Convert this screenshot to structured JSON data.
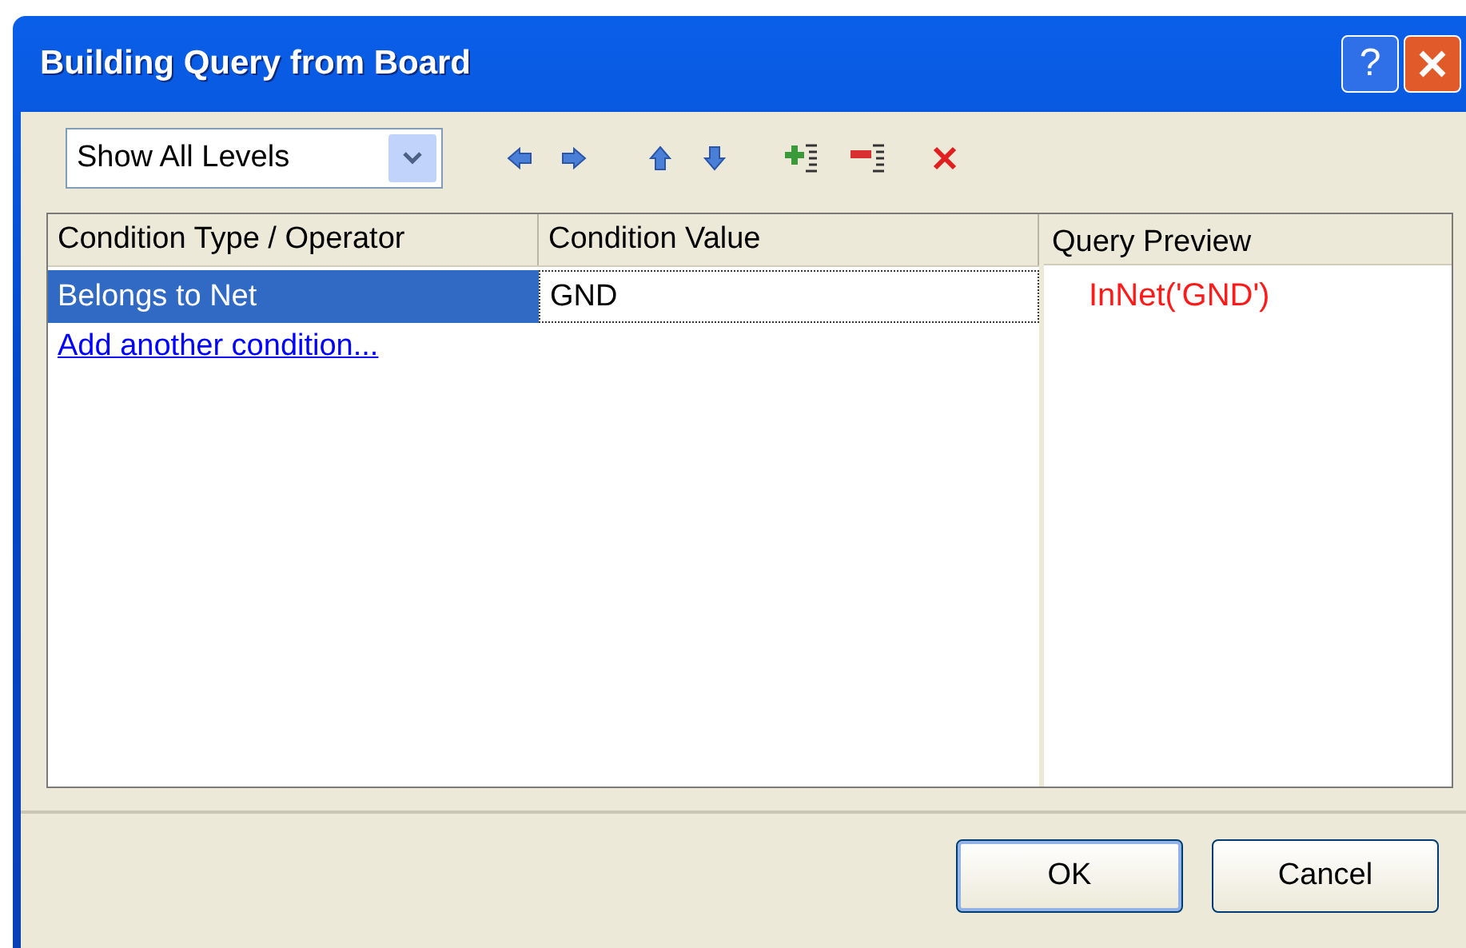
{
  "window": {
    "title": "Building Query from Board",
    "help_glyph": "?"
  },
  "level_filter": {
    "value": "Show All Levels"
  },
  "table": {
    "columns": [
      "Condition Type / Operator",
      "Condition Value"
    ],
    "rows": [
      {
        "type": "Belongs to Net",
        "value": "GND",
        "selected": true
      }
    ],
    "add_link": "Add another condition..."
  },
  "preview": {
    "title": "Query Preview",
    "query": "InNet('GND')"
  },
  "buttons": [
    {
      "label": "OK",
      "default": true
    },
    {
      "label": "Cancel",
      "default": false
    }
  ]
}
